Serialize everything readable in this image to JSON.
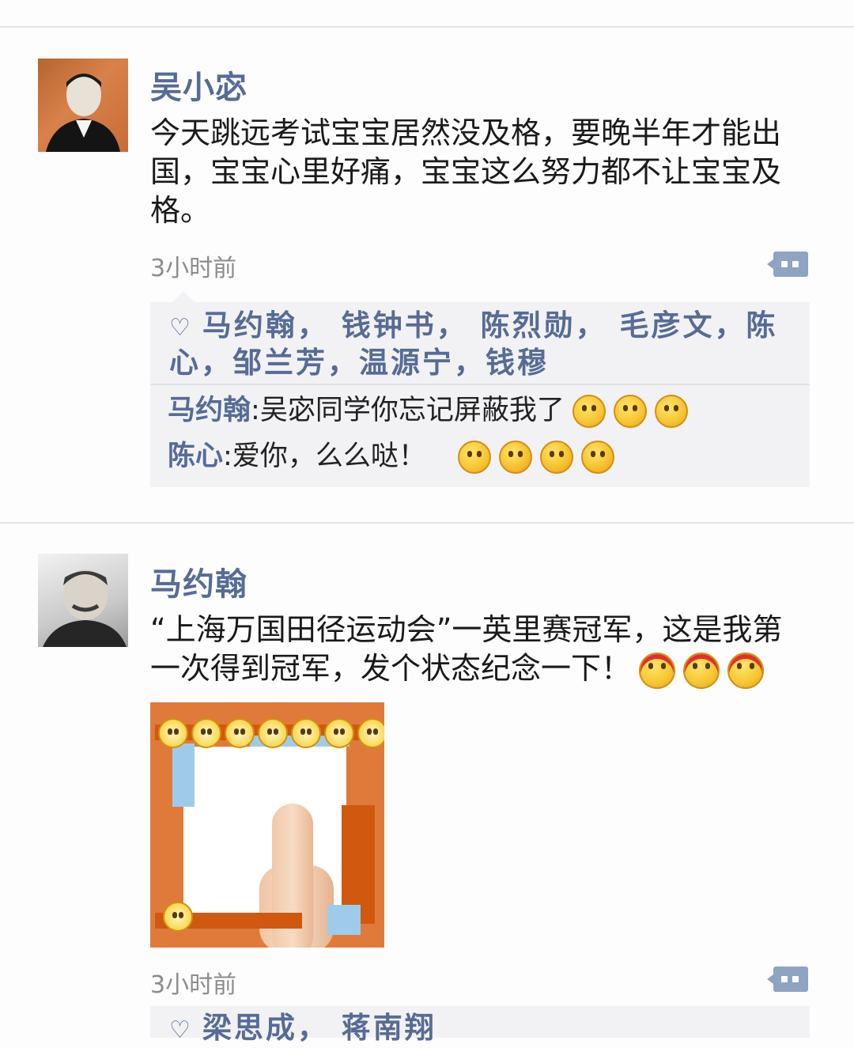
{
  "posts": [
    {
      "author": "吴小宓",
      "text": "今天跳远考试宝宝居然没及格，要晚半年才能出国，宝宝心里好痛，宝宝这么努力都不让宝宝及格。",
      "time": "3小时前",
      "likes": "马约翰， 钱钟书， 陈烈勋， 毛彦文，陈心，邹兰芳，温源宁，钱穆",
      "comments": [
        {
          "name": "马约翰",
          "sep": ":",
          "text": "吴宓同学你忘记屏蔽我了",
          "emojis": [
            "smile-icon",
            "smile-icon",
            "smile-icon"
          ]
        },
        {
          "name": "陈心",
          "sep": ":",
          "text": "爱你，么么哒！",
          "emojis": [
            "blush-icon",
            "kiss-icon",
            "kiss-icon",
            "kiss-icon"
          ]
        }
      ]
    },
    {
      "author": "马约翰",
      "text": "“上海万国田径运动会”一英里赛冠军，这是我第一次得到冠军，发个状态纪念一下！",
      "time": "3小时前",
      "likes_partial": "梁思成， 蒋南翔"
    }
  ],
  "colors": {
    "link": "#576b95",
    "panel": "#f2f2f5",
    "time": "#8c8c8c"
  }
}
